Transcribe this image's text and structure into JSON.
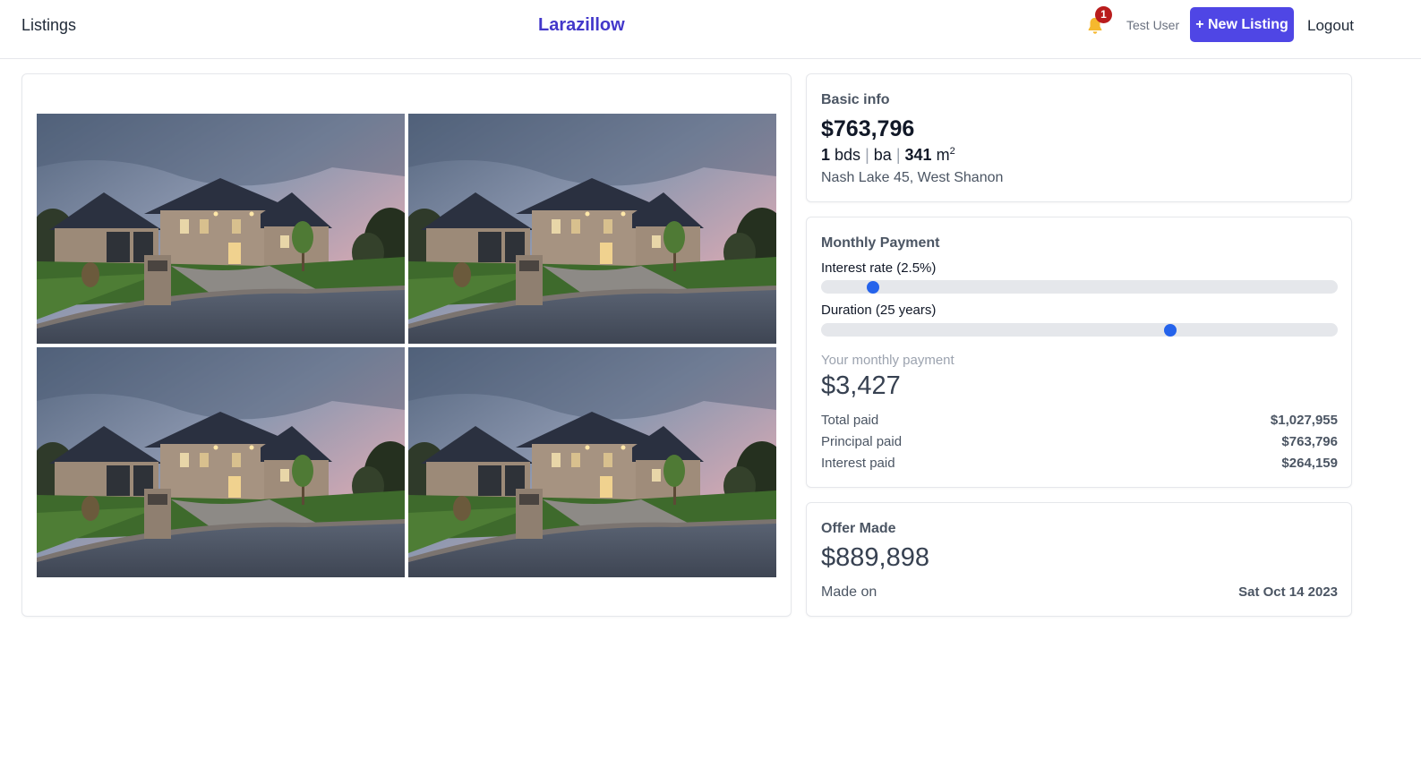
{
  "header": {
    "listings_link": "Listings",
    "brand": "Larazillow",
    "notification_count": "1",
    "user_name": "Test User",
    "new_listing_label": "+ New Listing",
    "logout_label": "Logout"
  },
  "gallery": {
    "photo_count": 4
  },
  "basic_info": {
    "title": "Basic info",
    "price": "$763,796",
    "beds": "1",
    "beds_label": "bds",
    "baths_label": "ba",
    "area": "341",
    "area_unit": "m",
    "area_exp": "2",
    "address": "Nash Lake 45, West Shanon"
  },
  "monthly_payment": {
    "title": "Monthly Payment",
    "interest_label": "Interest rate (2.5%)",
    "interest_slider_level": 0.09,
    "duration_label": "Duration (25 years)",
    "duration_slider_level": 0.68,
    "your_payment_label": "Your monthly payment",
    "monthly_amount": "$3,427",
    "rows": [
      {
        "label": "Total paid",
        "value": "$1,027,955"
      },
      {
        "label": "Principal paid",
        "value": "$763,796"
      },
      {
        "label": "Interest paid",
        "value": "$264,159"
      }
    ]
  },
  "offer": {
    "title": "Offer Made",
    "amount": "$889,898",
    "made_on_label": "Made on",
    "made_on_date": "Sat Oct 14 2023"
  },
  "colors": {
    "brand": "#4338ca",
    "primary_button": "#4f46e5",
    "slider_thumb": "#2563eb",
    "badge": "#b91c1c",
    "bell": "#f5b82e"
  }
}
